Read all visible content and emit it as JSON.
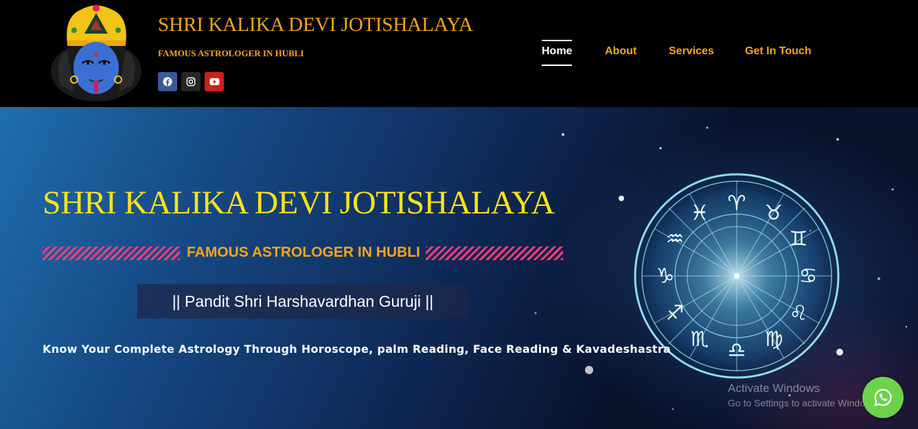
{
  "header": {
    "brand_title": "SHRI KALIKA DEVI JOTISHALAYA",
    "brand_subtitle": "FAMOUS ASTROLOGER IN HUBLI",
    "socials": [
      "facebook-icon",
      "instagram-icon",
      "youtube-icon"
    ]
  },
  "nav": {
    "items": [
      {
        "label": "Home",
        "active": true
      },
      {
        "label": "About",
        "active": false
      },
      {
        "label": "Services",
        "active": false
      },
      {
        "label": "Get In Touch",
        "active": false
      }
    ]
  },
  "hero": {
    "title": "SHRI KALIKA DEVI JOTISHALAYA",
    "subtitle": "FAMOUS ASTROLOGER IN HUBLI",
    "guru": "|| Pandit Shri Harshavardhan Guruji ||",
    "tagline": "Know Your Complete Astrology Through Horoscope, palm Reading, Face Reading & Kavadeshastra"
  },
  "watermark": {
    "title": "Activate Windows",
    "subtitle": "Go to Settings to activate Windows."
  },
  "colors": {
    "accent_orange": "#f7a51c",
    "hero_title_yellow": "#ffe21a",
    "stripe_pink": "#ff3d7a",
    "whatsapp_green": "#6bd34a"
  }
}
